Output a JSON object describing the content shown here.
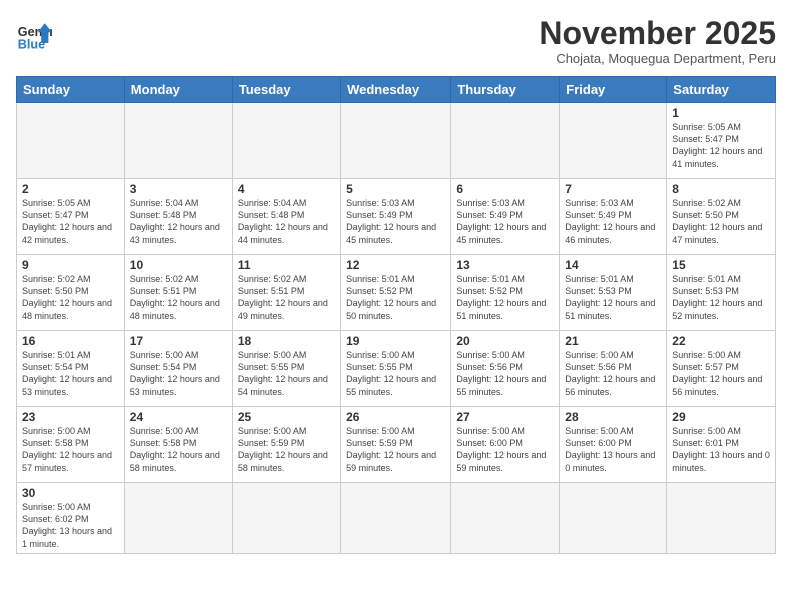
{
  "header": {
    "logo_general": "General",
    "logo_blue": "Blue",
    "month_title": "November 2025",
    "subtitle": "Chojata, Moquegua Department, Peru"
  },
  "days_of_week": [
    "Sunday",
    "Monday",
    "Tuesday",
    "Wednesday",
    "Thursday",
    "Friday",
    "Saturday"
  ],
  "weeks": [
    [
      {
        "day": "",
        "info": ""
      },
      {
        "day": "",
        "info": ""
      },
      {
        "day": "",
        "info": ""
      },
      {
        "day": "",
        "info": ""
      },
      {
        "day": "",
        "info": ""
      },
      {
        "day": "",
        "info": ""
      },
      {
        "day": "1",
        "info": "Sunrise: 5:05 AM\nSunset: 5:47 PM\nDaylight: 12 hours\nand 41 minutes."
      }
    ],
    [
      {
        "day": "2",
        "info": "Sunrise: 5:05 AM\nSunset: 5:47 PM\nDaylight: 12 hours\nand 42 minutes."
      },
      {
        "day": "3",
        "info": "Sunrise: 5:04 AM\nSunset: 5:48 PM\nDaylight: 12 hours\nand 43 minutes."
      },
      {
        "day": "4",
        "info": "Sunrise: 5:04 AM\nSunset: 5:48 PM\nDaylight: 12 hours\nand 44 minutes."
      },
      {
        "day": "5",
        "info": "Sunrise: 5:03 AM\nSunset: 5:49 PM\nDaylight: 12 hours\nand 45 minutes."
      },
      {
        "day": "6",
        "info": "Sunrise: 5:03 AM\nSunset: 5:49 PM\nDaylight: 12 hours\nand 45 minutes."
      },
      {
        "day": "7",
        "info": "Sunrise: 5:03 AM\nSunset: 5:49 PM\nDaylight: 12 hours\nand 46 minutes."
      },
      {
        "day": "8",
        "info": "Sunrise: 5:02 AM\nSunset: 5:50 PM\nDaylight: 12 hours\nand 47 minutes."
      }
    ],
    [
      {
        "day": "9",
        "info": "Sunrise: 5:02 AM\nSunset: 5:50 PM\nDaylight: 12 hours\nand 48 minutes."
      },
      {
        "day": "10",
        "info": "Sunrise: 5:02 AM\nSunset: 5:51 PM\nDaylight: 12 hours\nand 48 minutes."
      },
      {
        "day": "11",
        "info": "Sunrise: 5:02 AM\nSunset: 5:51 PM\nDaylight: 12 hours\nand 49 minutes."
      },
      {
        "day": "12",
        "info": "Sunrise: 5:01 AM\nSunset: 5:52 PM\nDaylight: 12 hours\nand 50 minutes."
      },
      {
        "day": "13",
        "info": "Sunrise: 5:01 AM\nSunset: 5:52 PM\nDaylight: 12 hours\nand 51 minutes."
      },
      {
        "day": "14",
        "info": "Sunrise: 5:01 AM\nSunset: 5:53 PM\nDaylight: 12 hours\nand 51 minutes."
      },
      {
        "day": "15",
        "info": "Sunrise: 5:01 AM\nSunset: 5:53 PM\nDaylight: 12 hours\nand 52 minutes."
      }
    ],
    [
      {
        "day": "16",
        "info": "Sunrise: 5:01 AM\nSunset: 5:54 PM\nDaylight: 12 hours\nand 53 minutes."
      },
      {
        "day": "17",
        "info": "Sunrise: 5:00 AM\nSunset: 5:54 PM\nDaylight: 12 hours\nand 53 minutes."
      },
      {
        "day": "18",
        "info": "Sunrise: 5:00 AM\nSunset: 5:55 PM\nDaylight: 12 hours\nand 54 minutes."
      },
      {
        "day": "19",
        "info": "Sunrise: 5:00 AM\nSunset: 5:55 PM\nDaylight: 12 hours\nand 55 minutes."
      },
      {
        "day": "20",
        "info": "Sunrise: 5:00 AM\nSunset: 5:56 PM\nDaylight: 12 hours\nand 55 minutes."
      },
      {
        "day": "21",
        "info": "Sunrise: 5:00 AM\nSunset: 5:56 PM\nDaylight: 12 hours\nand 56 minutes."
      },
      {
        "day": "22",
        "info": "Sunrise: 5:00 AM\nSunset: 5:57 PM\nDaylight: 12 hours\nand 56 minutes."
      }
    ],
    [
      {
        "day": "23",
        "info": "Sunrise: 5:00 AM\nSunset: 5:58 PM\nDaylight: 12 hours\nand 57 minutes."
      },
      {
        "day": "24",
        "info": "Sunrise: 5:00 AM\nSunset: 5:58 PM\nDaylight: 12 hours\nand 58 minutes."
      },
      {
        "day": "25",
        "info": "Sunrise: 5:00 AM\nSunset: 5:59 PM\nDaylight: 12 hours\nand 58 minutes."
      },
      {
        "day": "26",
        "info": "Sunrise: 5:00 AM\nSunset: 5:59 PM\nDaylight: 12 hours\nand 59 minutes."
      },
      {
        "day": "27",
        "info": "Sunrise: 5:00 AM\nSunset: 6:00 PM\nDaylight: 12 hours\nand 59 minutes."
      },
      {
        "day": "28",
        "info": "Sunrise: 5:00 AM\nSunset: 6:00 PM\nDaylight: 13 hours\nand 0 minutes."
      },
      {
        "day": "29",
        "info": "Sunrise: 5:00 AM\nSunset: 6:01 PM\nDaylight: 13 hours\nand 0 minutes."
      }
    ],
    [
      {
        "day": "30",
        "info": "Sunrise: 5:00 AM\nSunset: 6:02 PM\nDaylight: 13 hours\nand 1 minute."
      },
      {
        "day": "",
        "info": ""
      },
      {
        "day": "",
        "info": ""
      },
      {
        "day": "",
        "info": ""
      },
      {
        "day": "",
        "info": ""
      },
      {
        "day": "",
        "info": ""
      },
      {
        "day": "",
        "info": ""
      }
    ]
  ]
}
